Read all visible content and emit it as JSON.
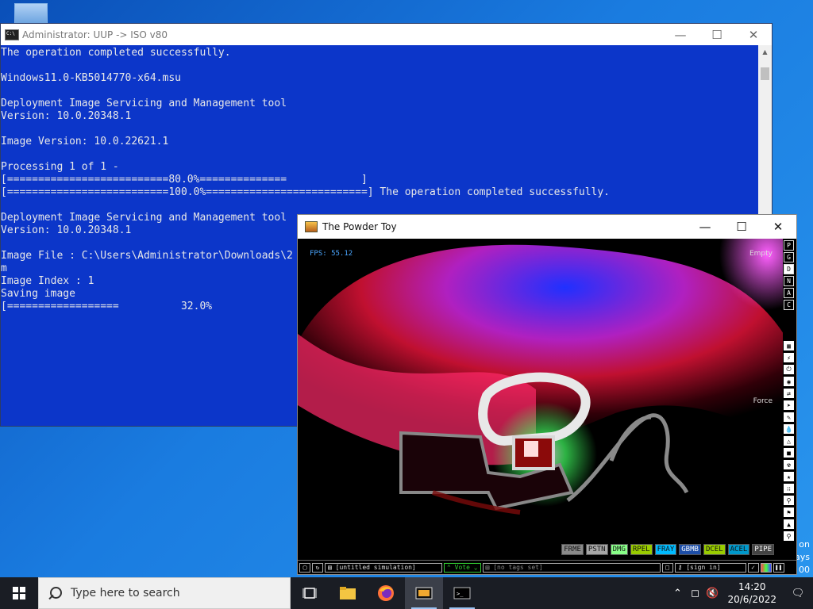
{
  "cmd": {
    "title": "Administrator:  UUP -> ISO v80",
    "lines": [
      "The operation completed successfully.",
      "",
      "Windows11.0-KB5014770-x64.msu",
      "",
      "Deployment Image Servicing and Management tool",
      "Version: 10.0.20348.1",
      "",
      "Image Version: 10.0.22621.1",
      "",
      "Processing 1 of 1 -",
      "[==========================80.0%==============            ]",
      "[==========================100.0%==========================] The operation completed successfully.",
      "",
      "Deployment Image Servicing and Management tool",
      "Version: 10.0.20348.1",
      "",
      "Image File : C:\\Users\\Administrator\\Downloads\\2",
      "m",
      "Image Index : 1",
      "Saving image",
      "[==================          32.0%"
    ]
  },
  "ptoy": {
    "title": "The Powder Toy",
    "fps": "FPS: 55.12",
    "hud_empty": "Empty",
    "hud_force": "Force",
    "menu_letters": [
      "P",
      "G",
      "D",
      "N",
      "A",
      "C"
    ],
    "active_letter": "D",
    "elements": [
      {
        "label": "FRME",
        "color": "#8a8a8a"
      },
      {
        "label": "PSTN",
        "color": "#a6a6a6"
      },
      {
        "label": "DMG",
        "color": "#88ff88"
      },
      {
        "label": "RPEL",
        "color": "#99cc00"
      },
      {
        "label": "FRAY",
        "color": "#00bbff"
      },
      {
        "label": "GBMB",
        "color": "#1e4fa8"
      },
      {
        "label": "DCEL",
        "color": "#99cc00"
      },
      {
        "label": "ACEL",
        "color": "#0099cc"
      },
      {
        "label": "PIPE",
        "color": "#444444"
      }
    ],
    "bottom": {
      "simulation": "[untitled simulation]",
      "vote": "Vote",
      "tags": "[no tags set]",
      "sign_in": "[sign in]"
    }
  },
  "desktop_behind": {
    "line1": "on",
    "line2": "ays",
    "line3": "00"
  },
  "taskbar": {
    "search_placeholder": "Type here to search",
    "time": "14:20",
    "date": "20/6/2022"
  }
}
